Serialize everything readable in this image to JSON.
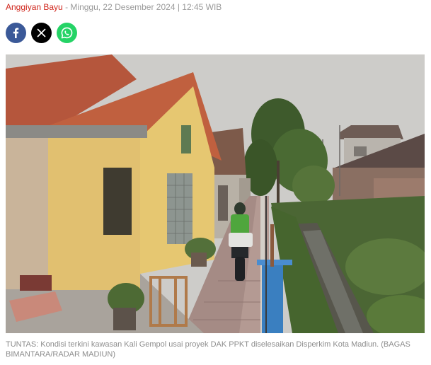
{
  "article": {
    "author": "Anggiyan Bayu",
    "separator": " - ",
    "date": "Minggu, 22 Desember 2024 | 12:45 WIB"
  },
  "share": [
    {
      "name": "facebook-share-button",
      "icon": "facebook-icon",
      "color": "#3b5998"
    },
    {
      "name": "x-share-button",
      "icon": "x-icon",
      "color": "#000000"
    },
    {
      "name": "whatsapp-share-button",
      "icon": "whatsapp-icon",
      "color": "#25d366"
    }
  ],
  "photo": {
    "caption": "TUNTAS: Kondisi terkini kawasan Kali Gempol usai proyek DAK PPKT diselesaikan Disperkim Kota Madiun. (BAGAS BIMANTARA/RADAR MADIUN)"
  }
}
